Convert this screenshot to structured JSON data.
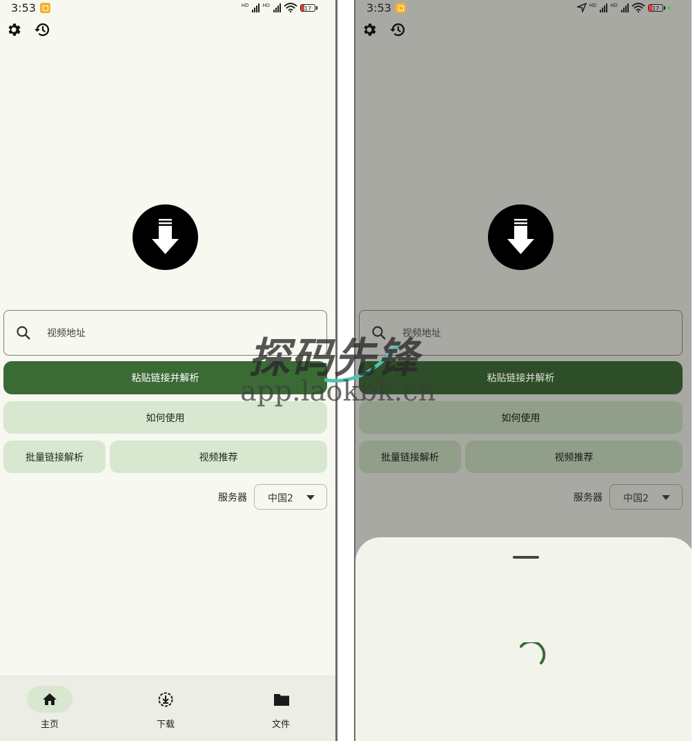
{
  "status_bar": {
    "time": "3:53",
    "battery": "17",
    "hd": "HD"
  },
  "search": {
    "placeholder": "视频地址"
  },
  "buttons": {
    "paste_parse": "粘贴链接并解析",
    "how_to_use": "如何使用",
    "batch_parse": "批量链接解析",
    "video_recommend": "视频推荐"
  },
  "server": {
    "label": "服务器",
    "selected": "中国2"
  },
  "nav": {
    "items": [
      {
        "label": "主页",
        "icon": "home-icon",
        "active": true
      },
      {
        "label": "下载",
        "icon": "download-circle-icon",
        "active": false
      },
      {
        "label": "文件",
        "icon": "folder-icon",
        "active": false
      }
    ]
  },
  "watermark": {
    "brand": "探码先锋",
    "url": "app.laokbk.cn"
  },
  "colors": {
    "background": "#f7f8ef",
    "primary": "#3a6b35",
    "tonal": "#d8e7cf",
    "scrim": "#a8a9a3",
    "sheet": "#f2f3ea"
  }
}
